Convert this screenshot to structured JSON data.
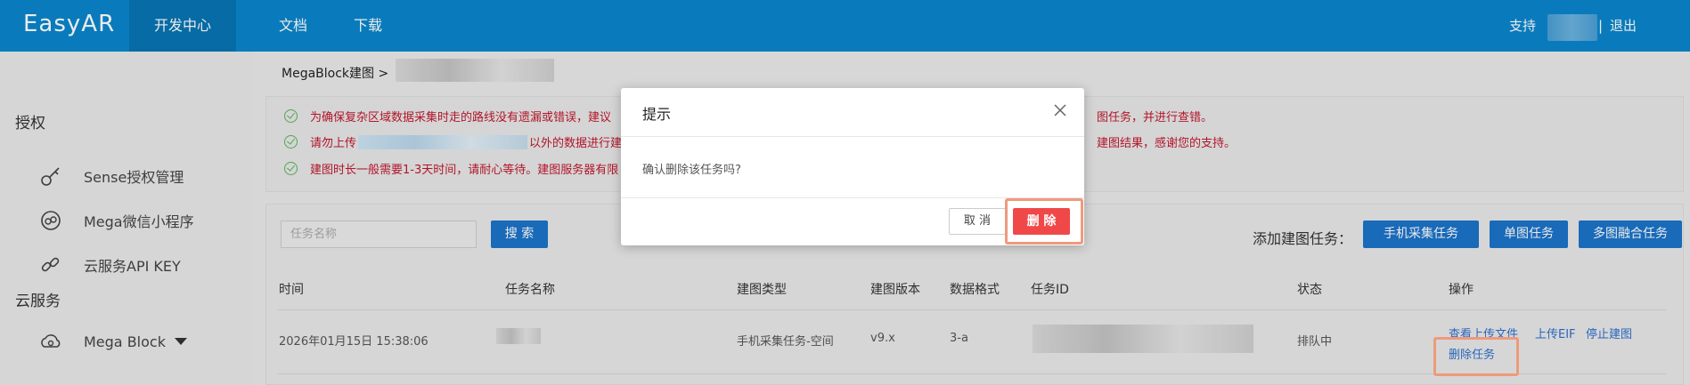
{
  "topbar": {
    "logo": "EasyAR",
    "nav": [
      "开发中心",
      "文档",
      "下载"
    ],
    "support": "支持",
    "divider": "|",
    "logout": "退出"
  },
  "sidebar": {
    "sections": [
      {
        "heading": "授权",
        "items": [
          {
            "label": "Sense授权管理",
            "icon": "key-icon"
          },
          {
            "label": "Mega微信小程序",
            "icon": "miniprogram-icon"
          },
          {
            "label": "云服务API KEY",
            "icon": "link-icon"
          }
        ]
      },
      {
        "heading": "云服务",
        "items": [
          {
            "label": "Mega Block",
            "icon": "cloud-icon"
          }
        ]
      }
    ]
  },
  "breadcrumb": "MegaBlock建图 >",
  "notices": [
    {
      "left": "为确保复杂区域数据采集时走的路线没有遗漏或错误，建议",
      "right": "图任务，并进行查错。"
    },
    {
      "left": "请勿上传",
      "middle": "以外的数据进行建图",
      "right": "建图结果，感谢您的支持。"
    },
    {
      "left": "建图时长一般需要1-3天时间，请耐心等待。建图服务器有限"
    }
  ],
  "toolbar": {
    "search_placeholder": "任务名称",
    "search_button": "搜 索",
    "add_label": "添加建图任务：",
    "add_buttons": [
      "手机采集任务",
      "单图任务",
      "多图融合任务"
    ]
  },
  "table": {
    "headers": [
      "时间",
      "任务名称",
      "建图类型",
      "建图版本",
      "数据格式",
      "任务ID",
      "状态",
      "操作"
    ],
    "rows": [
      {
        "time": "2026年01月15日 15:38:06",
        "type": "手机采集任务-空间",
        "version": "v9.x",
        "format": "3-a",
        "status": "排队中",
        "actions": [
          "查看上传文件",
          "上传EIF",
          "停止建图",
          "删除任务"
        ]
      }
    ]
  },
  "dialog": {
    "title": "提示",
    "message": "确认删除该任务吗?",
    "cancel": "取 消",
    "confirm": "删 除"
  },
  "colors": {
    "brand": "#0a86cc",
    "primary_button": "#1c74c9",
    "danger": "#f04848",
    "notice_text": "#c0172d",
    "highlight": "#ee9a7c"
  }
}
